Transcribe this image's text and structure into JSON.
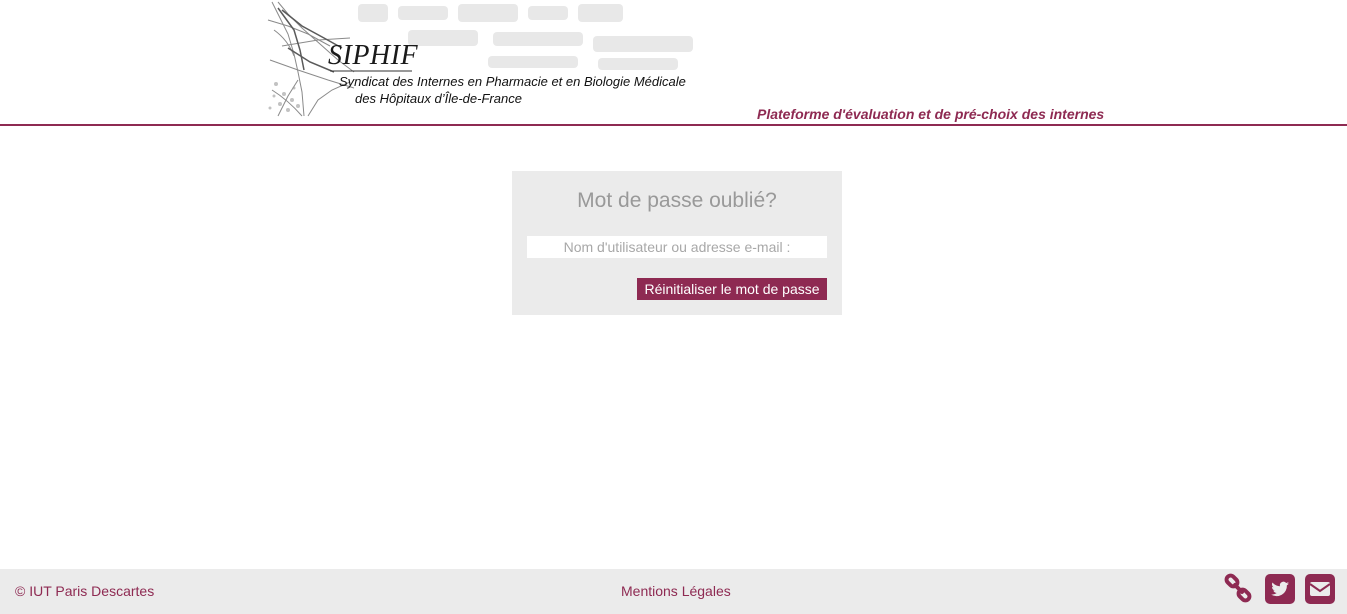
{
  "header": {
    "logo_title": "SIPHIF",
    "logo_line1": "Syndicat des Internes en Pharmacie et en Biologie Médicale",
    "logo_line2": "des Hôpitaux d’Île-de-France",
    "tagline": "Plateforme d'évaluation et de pré-choix des internes"
  },
  "reset_form": {
    "title": "Mot de passe oublié?",
    "username_placeholder": "Nom d'utilisateur ou adresse e-mail :",
    "username_value": "",
    "submit_label": "Réinitialiser le mot de passe"
  },
  "footer": {
    "copyright": "© IUT Paris Descartes",
    "legal_link": "Mentions Légales",
    "icons": [
      "link-icon",
      "twitter-icon",
      "mail-icon"
    ]
  },
  "colors": {
    "accent": "#8e2a52",
    "panel_bg": "#ebebeb",
    "title_gray": "#999999"
  }
}
